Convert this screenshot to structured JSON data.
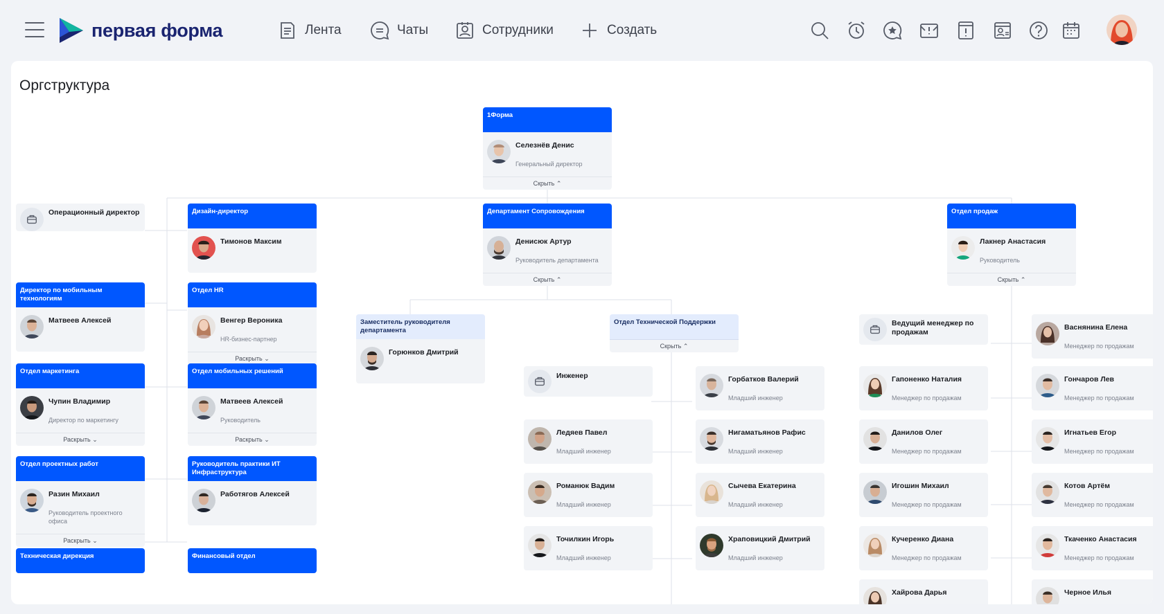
{
  "app": {
    "brand": "первая форма"
  },
  "nav": [
    {
      "label": "Лента",
      "icon": "feed-icon"
    },
    {
      "label": "Чаты",
      "icon": "chat-icon"
    },
    {
      "label": "Сотрудники",
      "icon": "employees-icon"
    },
    {
      "label": "Создать",
      "icon": "plus-icon"
    }
  ],
  "toolbar_icons": [
    "search-icon",
    "alarm-icon",
    "star-bubble-icon",
    "notice-icon",
    "task-icon",
    "profile-card-icon",
    "help-icon",
    "calendar-icon"
  ],
  "colors": {
    "accent": "#0057ff",
    "light_header": "#e3ecfd",
    "brand_dark": "#1a2470",
    "brand_teal": "#12b5a0"
  },
  "page": {
    "title": "Оргструктура"
  },
  "org": {
    "root": {
      "unit": "1Форма",
      "name": "Селезнёв Денис",
      "role": "Генеральный директор",
      "toggle": "Скрыть"
    },
    "ops_director": {
      "name": "Операционный директор"
    },
    "design_director": {
      "unit": "Дизайн-директор",
      "name": "Тимонов Максим"
    },
    "support_dept": {
      "unit": "Департамент Сопровождения",
      "name": "Денисюк Артур",
      "role": "Руководитель департамента",
      "toggle": "Скрыть"
    },
    "sales_dept": {
      "unit": "Отдел продаж",
      "name": "Лакнер Анастасия",
      "role": "Руководитель",
      "toggle": "Скрыть"
    },
    "mobile_tech_director": {
      "unit": "Директор по мобильным технологиям",
      "name": "Матвеев Алексей"
    },
    "hr_dept": {
      "unit": "Отдел HR",
      "name": "Венгер Вероника",
      "role": "HR-бизнес-партнер",
      "toggle": "Раскрыть"
    },
    "deputy_head": {
      "unit": "Заместитель руководителя департамента",
      "name": "Горюнков Дмитрий"
    },
    "tech_support": {
      "unit": "Отдел Технической Поддержки",
      "toggle": "Скрыть"
    },
    "lead_sales_manager": {
      "name": "Ведущий менеджер по продажам"
    },
    "marketing": {
      "unit": "Отдел маркетинга",
      "name": "Чупин Владимир",
      "role": "Директор по маркетингу",
      "toggle": "Раскрыть"
    },
    "mobile_solutions": {
      "unit": "Отдел мобильных решений",
      "name": "Матвеев Алексей",
      "role": "Руководитель",
      "toggle": "Раскрыть"
    },
    "project_works": {
      "unit": "Отдел проектных работ",
      "name": "Разин Михаил",
      "role": "Руководитель проектного офиса",
      "toggle": "Раскрыть"
    },
    "it_infra": {
      "unit": "Руководитель практики ИТ Инфраструктура",
      "name": "Работягов Алексей"
    },
    "tech_directorate": {
      "unit": "Техническая дирекция"
    },
    "finance": {
      "unit": "Финансовый отдел"
    },
    "engineer": {
      "name": "Инженер"
    },
    "support_staff": [
      {
        "name": "Ледяев Павел",
        "role": "Младший инженер"
      },
      {
        "name": "Романюк Вадим",
        "role": "Младший инженер"
      },
      {
        "name": "Точилкин Игорь",
        "role": "Младший инженер"
      },
      {
        "name": "Горбатков Валерий",
        "role": "Младший инженер"
      },
      {
        "name": "Нигаматьянов Рафис",
        "role": "Младший инженер"
      },
      {
        "name": "Сычева Екатерина",
        "role": "Младший инженер"
      },
      {
        "name": "Храповицкий Дмитрий",
        "role": "Младший инженер"
      }
    ],
    "sales_staff_left": [
      {
        "name": "Гапоненко Наталия",
        "role": "Менеджер по продажам"
      },
      {
        "name": "Данилов Олег",
        "role": "Менеджер по продажам"
      },
      {
        "name": "Игошин Михаил",
        "role": "Менеджер по продажам"
      },
      {
        "name": "Кучеренко Диана",
        "role": "Менеджер по продажам"
      },
      {
        "name": "Хайрова Дарья",
        "role": ""
      }
    ],
    "sales_staff_right": [
      {
        "name": "Васнянина Елена",
        "role": "Менеджер по продажам"
      },
      {
        "name": "Гончаров Лев",
        "role": "Менеджер по продажам"
      },
      {
        "name": "Игнатьев Егор",
        "role": "Менеджер по продажам"
      },
      {
        "name": "Котов Артём",
        "role": "Менеджер по продажам"
      },
      {
        "name": "Ткаченко Анастасия",
        "role": "Менеджер по продажам"
      },
      {
        "name": "Черное Илья",
        "role": ""
      }
    ]
  }
}
